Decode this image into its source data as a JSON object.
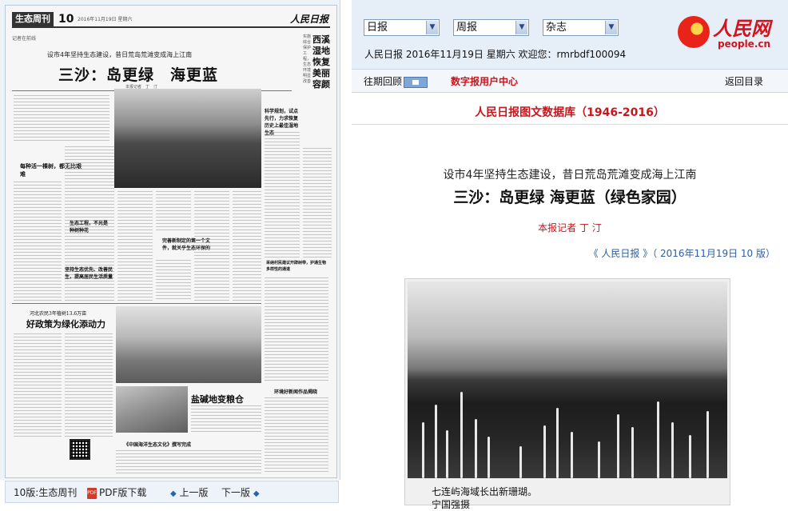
{
  "newspaper": {
    "section": "生态周刊",
    "page_no": "10",
    "date_line": "2016年11月19日 星期六",
    "masthead": "人民日报",
    "kicker": "记者在前线",
    "subtitle": "设市4年坚持生态建设，昔日荒岛荒滩变成海上江南",
    "title": "三沙：岛更绿　海更蓝",
    "byline": "本报记者　丁　汀",
    "side_title": "西溪湿地恢复美丽容颜",
    "side_sub": "实施综合保护工程，生态环境明显改善",
    "col_head_1": "科学规划，试点先行，力求恢复历史上最佳湿地生态",
    "col_head_2": "每种活一棵树，都无比艰难",
    "col_head_3": "生态工程，不光是种树种花",
    "col_head_4": "完善新制定的第一个文件，就关乎生态环保的",
    "col_head_5": "坚持生态优先、改善民生，提高居民生活质量",
    "col_head_6": "河北农民3年植树13.6万亩",
    "col_head_7": "好政策为绿化添动力",
    "col_head_8": "盐碱地变粮仓",
    "col_head_9": "《中国海洋生态文化》撰写完成",
    "col_head_10": "环境好新闻作品揭晓",
    "col_head_11": "采纳村民建议开辟树带，护通生物多样性的通道"
  },
  "paper_nav": {
    "edition": "10版:生态周刊",
    "pdf": "PDF版下载",
    "prev": "上一版",
    "next": "下一版",
    "pdf_icon": "PDF"
  },
  "header": {
    "select_1": "日报",
    "select_2": "周报",
    "select_3": "杂志",
    "user_line": "人民日报  2016年11月19日  星期六  欢迎您：",
    "username": "rmrbdf100094",
    "logo_cn": "人民网",
    "logo_en": "people.cn"
  },
  "subnav": {
    "past_review": "往期回顾",
    "digital_center": "数字报用户中心",
    "back": "返回目录"
  },
  "article": {
    "db_title": "人民日报图文数据库（1946-2016）",
    "subtitle": "设市4年坚持生态建设，昔日荒岛荒滩变成海上江南",
    "title": "三沙：岛更绿 海更蓝（绿色家园）",
    "author": "本报记者  丁  汀",
    "source": "《  人民日报  》（  2016年11月19日   10 版）",
    "caption_1": "七连屿海域长出新珊瑚。",
    "caption_2": "宁国强摄"
  },
  "colors": {
    "accent_red": "#c8161d",
    "link_blue": "#2a5ea8",
    "header_bg": "#e6eef8"
  }
}
